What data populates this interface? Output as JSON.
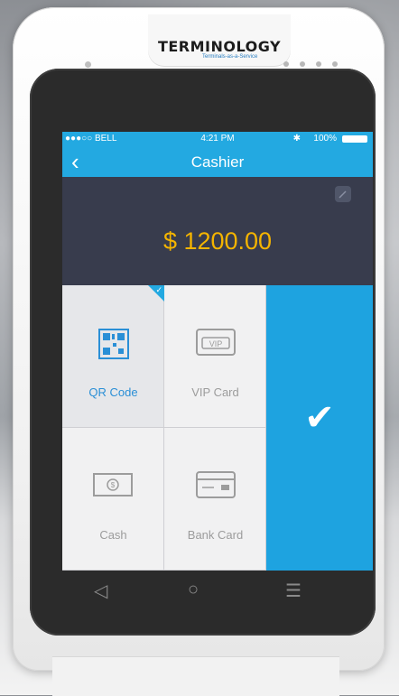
{
  "brand": {
    "logo": "TERMINOLOGY",
    "tagline": "Terminals-as-a-Service"
  },
  "status": {
    "carrier": "●●●○○ BELL",
    "time": "4:21 PM",
    "battery": "100%",
    "bt": "✱"
  },
  "nav": {
    "title": "Cashier",
    "back": "‹"
  },
  "payment": {
    "amount": "$ 1200.00"
  },
  "methods": [
    {
      "label": "QR Code",
      "icon": "qr-code-icon",
      "selected": true
    },
    {
      "label": "VIP Card",
      "icon": "vip-card-icon",
      "selected": false
    },
    {
      "label": "Cash",
      "icon": "cash-icon",
      "selected": false
    },
    {
      "label": "Bank Card",
      "icon": "bank-card-icon",
      "selected": false
    }
  ],
  "confirm": {
    "symbol": "✔"
  },
  "android": {
    "back": "◁",
    "home": "○",
    "menu": "☰"
  },
  "colors": {
    "accent": "#23a9e1",
    "amount": "#f4b400",
    "panel": "#383c4d"
  }
}
